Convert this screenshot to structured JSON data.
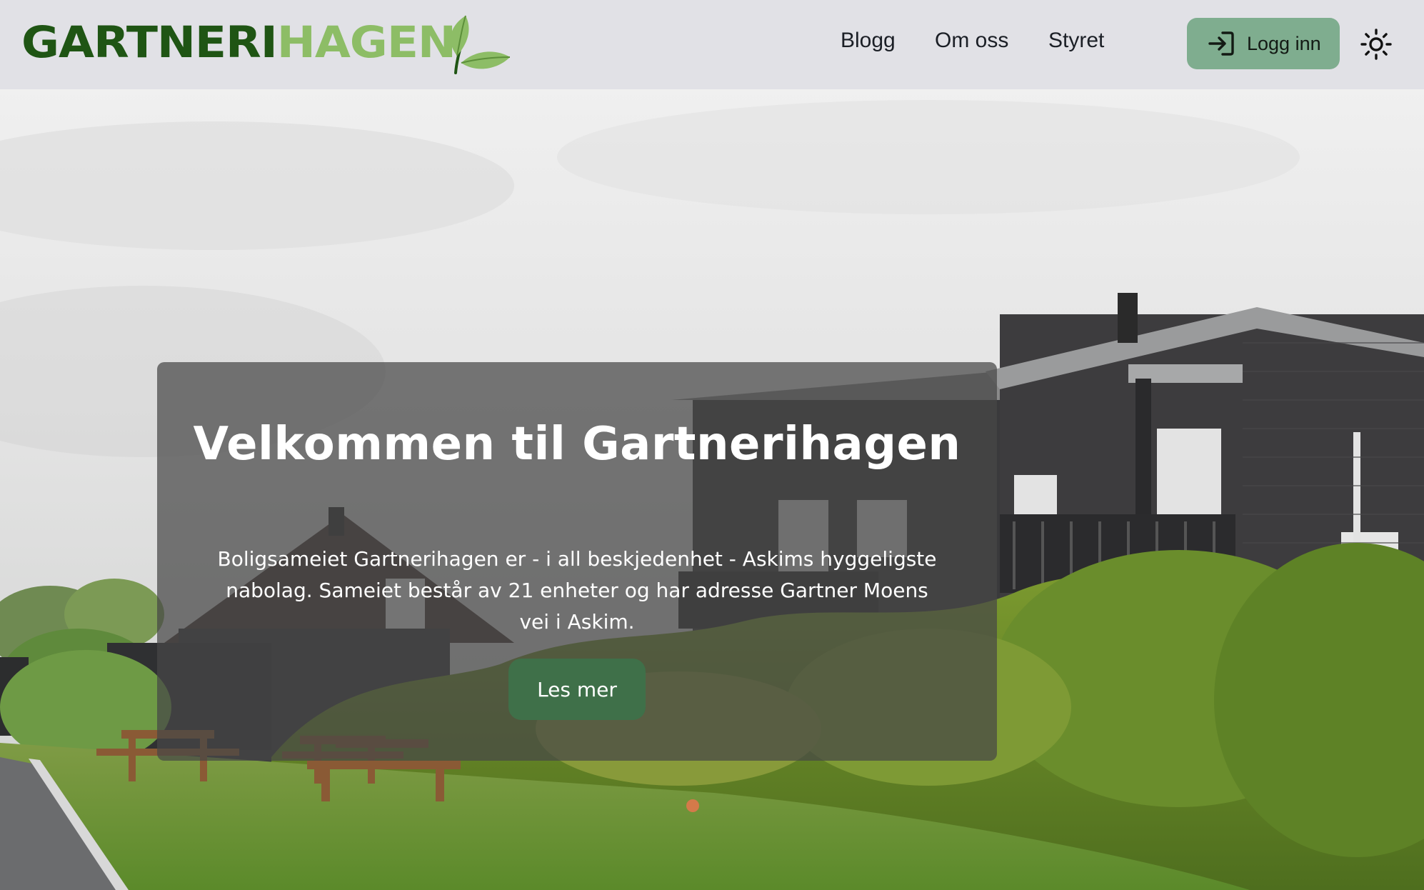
{
  "header": {
    "logo": {
      "dark_text": "GARTNERI",
      "light_text": "HAGEN",
      "icon": "leaf-icon"
    },
    "nav": [
      {
        "label": "Blogg"
      },
      {
        "label": "Om oss"
      },
      {
        "label": "Styret"
      }
    ],
    "login": {
      "label": "Logg inn",
      "icon": "login-arrow-icon"
    },
    "theme_toggle": {
      "icon": "sun-icon"
    }
  },
  "hero": {
    "title": "Velkommen til Gartnerihagen",
    "text": "Boligsameiet Gartnerihagen er - i all beskjedenhet - Askims hyggeligste nabolag. Sameiet består av 21 enheter og har adresse Gartner Moens vei i Askim.",
    "button_label": "Les mer"
  },
  "colors": {
    "header_bg": "#e1e1e6",
    "logo_dark": "#1f5514",
    "logo_light": "#8dbd66",
    "login_bg": "#7fad8f",
    "button_bg": "#3f7049",
    "panel_overlay": "rgba(70,70,70,0.72)"
  }
}
